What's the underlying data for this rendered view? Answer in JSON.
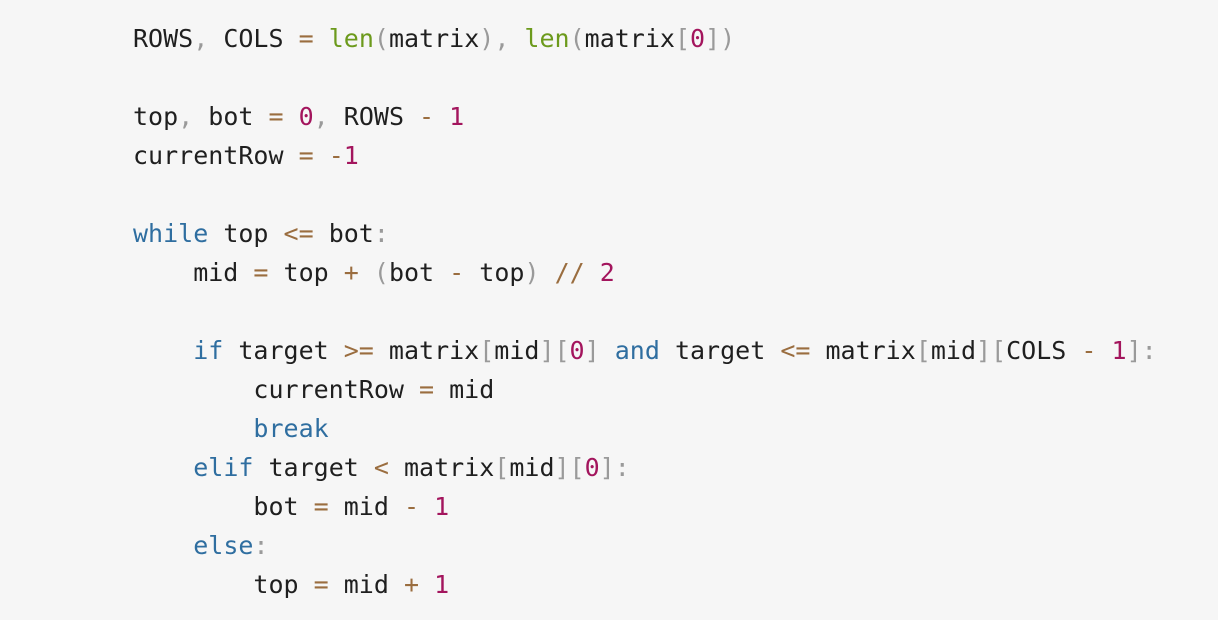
{
  "colors": {
    "background": "#f6f6f6",
    "keyword": "#2f6ea0",
    "number": "#a3155d",
    "operator": "#9a6d3f",
    "punctuation": "#9a9a9a",
    "builtin_function": "#6c9a1c",
    "identifier": "#1f1f1f"
  },
  "code": {
    "lines": [
      {
        "tokens": [
          {
            "t": "ROWS",
            "c": "id"
          },
          {
            "t": ",",
            "c": "pun"
          },
          {
            "t": " COLS ",
            "c": "id"
          },
          {
            "t": "=",
            "c": "op"
          },
          {
            "t": " ",
            "c": "id"
          },
          {
            "t": "len",
            "c": "fn"
          },
          {
            "t": "(",
            "c": "pun"
          },
          {
            "t": "matrix",
            "c": "id"
          },
          {
            "t": ")",
            "c": "pun"
          },
          {
            "t": ", ",
            "c": "pun"
          },
          {
            "t": "len",
            "c": "fn"
          },
          {
            "t": "(",
            "c": "pun"
          },
          {
            "t": "matrix",
            "c": "id"
          },
          {
            "t": "[",
            "c": "pun"
          },
          {
            "t": "0",
            "c": "num"
          },
          {
            "t": "])",
            "c": "pun"
          }
        ]
      },
      {
        "tokens": []
      },
      {
        "tokens": [
          {
            "t": "top",
            "c": "id"
          },
          {
            "t": ",",
            "c": "pun"
          },
          {
            "t": " bot ",
            "c": "id"
          },
          {
            "t": "=",
            "c": "op"
          },
          {
            "t": " ",
            "c": "id"
          },
          {
            "t": "0",
            "c": "num"
          },
          {
            "t": ",",
            "c": "pun"
          },
          {
            "t": " ROWS ",
            "c": "id"
          },
          {
            "t": "-",
            "c": "op"
          },
          {
            "t": " ",
            "c": "id"
          },
          {
            "t": "1",
            "c": "num"
          }
        ]
      },
      {
        "tokens": [
          {
            "t": "currentRow ",
            "c": "id"
          },
          {
            "t": "=",
            "c": "op"
          },
          {
            "t": " ",
            "c": "id"
          },
          {
            "t": "-",
            "c": "op"
          },
          {
            "t": "1",
            "c": "num"
          }
        ]
      },
      {
        "tokens": []
      },
      {
        "tokens": [
          {
            "t": "while",
            "c": "kw"
          },
          {
            "t": " top ",
            "c": "id"
          },
          {
            "t": "<=",
            "c": "op"
          },
          {
            "t": " bot",
            "c": "id"
          },
          {
            "t": ":",
            "c": "pun"
          }
        ]
      },
      {
        "tokens": [
          {
            "t": "    mid ",
            "c": "id"
          },
          {
            "t": "=",
            "c": "op"
          },
          {
            "t": " top ",
            "c": "id"
          },
          {
            "t": "+",
            "c": "op"
          },
          {
            "t": " ",
            "c": "id"
          },
          {
            "t": "(",
            "c": "pun"
          },
          {
            "t": "bot ",
            "c": "id"
          },
          {
            "t": "-",
            "c": "op"
          },
          {
            "t": " top",
            "c": "id"
          },
          {
            "t": ")",
            "c": "pun"
          },
          {
            "t": " ",
            "c": "id"
          },
          {
            "t": "//",
            "c": "op"
          },
          {
            "t": " ",
            "c": "id"
          },
          {
            "t": "2",
            "c": "num"
          }
        ]
      },
      {
        "tokens": []
      },
      {
        "tokens": [
          {
            "t": "    ",
            "c": "id"
          },
          {
            "t": "if",
            "c": "kw"
          },
          {
            "t": " target ",
            "c": "id"
          },
          {
            "t": ">=",
            "c": "op"
          },
          {
            "t": " matrix",
            "c": "id"
          },
          {
            "t": "[",
            "c": "pun"
          },
          {
            "t": "mid",
            "c": "id"
          },
          {
            "t": "][",
            "c": "pun"
          },
          {
            "t": "0",
            "c": "num"
          },
          {
            "t": "]",
            "c": "pun"
          },
          {
            "t": " ",
            "c": "id"
          },
          {
            "t": "and",
            "c": "kw"
          },
          {
            "t": " target ",
            "c": "id"
          },
          {
            "t": "<=",
            "c": "op"
          },
          {
            "t": " matrix",
            "c": "id"
          },
          {
            "t": "[",
            "c": "pun"
          },
          {
            "t": "mid",
            "c": "id"
          },
          {
            "t": "][",
            "c": "pun"
          },
          {
            "t": "COLS ",
            "c": "id"
          },
          {
            "t": "-",
            "c": "op"
          },
          {
            "t": " ",
            "c": "id"
          },
          {
            "t": "1",
            "c": "num"
          },
          {
            "t": "]:",
            "c": "pun"
          }
        ]
      },
      {
        "tokens": [
          {
            "t": "        currentRow ",
            "c": "id"
          },
          {
            "t": "=",
            "c": "op"
          },
          {
            "t": " mid",
            "c": "id"
          }
        ]
      },
      {
        "tokens": [
          {
            "t": "        ",
            "c": "id"
          },
          {
            "t": "break",
            "c": "kw"
          }
        ]
      },
      {
        "tokens": [
          {
            "t": "    ",
            "c": "id"
          },
          {
            "t": "elif",
            "c": "kw"
          },
          {
            "t": " target ",
            "c": "id"
          },
          {
            "t": "<",
            "c": "op"
          },
          {
            "t": " matrix",
            "c": "id"
          },
          {
            "t": "[",
            "c": "pun"
          },
          {
            "t": "mid",
            "c": "id"
          },
          {
            "t": "][",
            "c": "pun"
          },
          {
            "t": "0",
            "c": "num"
          },
          {
            "t": "]:",
            "c": "pun"
          }
        ]
      },
      {
        "tokens": [
          {
            "t": "        bot ",
            "c": "id"
          },
          {
            "t": "=",
            "c": "op"
          },
          {
            "t": " mid ",
            "c": "id"
          },
          {
            "t": "-",
            "c": "op"
          },
          {
            "t": " ",
            "c": "id"
          },
          {
            "t": "1",
            "c": "num"
          }
        ]
      },
      {
        "tokens": [
          {
            "t": "    ",
            "c": "id"
          },
          {
            "t": "else",
            "c": "kw"
          },
          {
            "t": ":",
            "c": "pun"
          }
        ]
      },
      {
        "tokens": [
          {
            "t": "        top ",
            "c": "id"
          },
          {
            "t": "=",
            "c": "op"
          },
          {
            "t": " mid ",
            "c": "id"
          },
          {
            "t": "+",
            "c": "op"
          },
          {
            "t": " ",
            "c": "id"
          },
          {
            "t": "1",
            "c": "num"
          }
        ]
      }
    ]
  }
}
